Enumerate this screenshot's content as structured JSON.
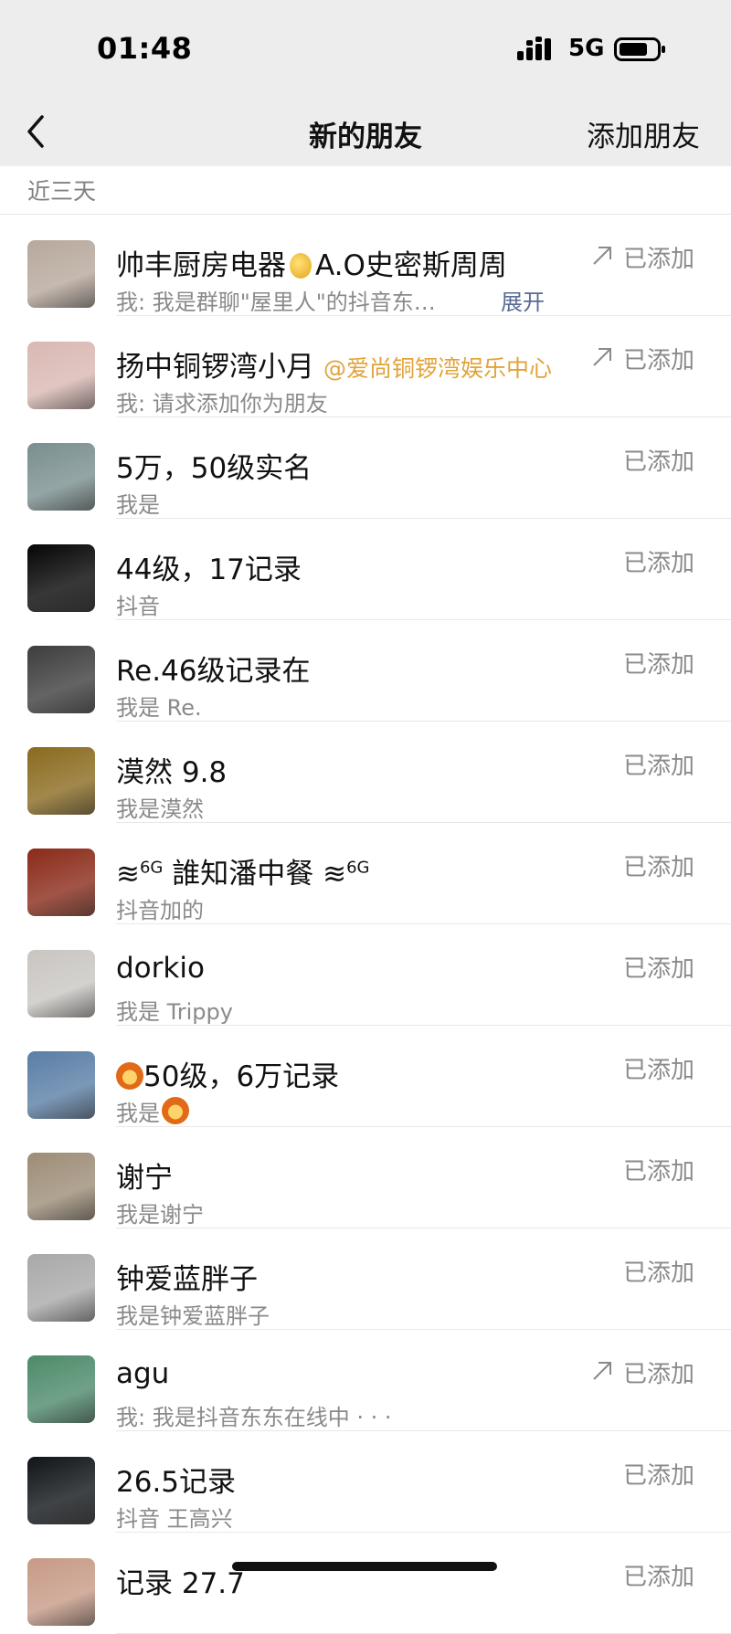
{
  "status_bar": {
    "time": "01:48",
    "network": "5G"
  },
  "nav": {
    "title": "新的朋友",
    "right_action": "添加朋友"
  },
  "section": {
    "label": "近三天"
  },
  "friends": [
    {
      "name": "帅丰厨房电器",
      "name_after": "A.O史密斯周周",
      "message": "我: 我是群聊\"屋里人\"的抖音东…",
      "expand": "展开",
      "status": "已添加",
      "shared": true,
      "avatar_color": "#b7a89c"
    },
    {
      "name": "扬中铜锣湾小月",
      "tag": "@爱尚铜锣湾娱乐中心",
      "message": "我: 请求添加你为朋友",
      "status": "已添加",
      "shared": true,
      "avatar_color": "#d9b8b3"
    },
    {
      "name": "5万，50级实名",
      "message": "我是",
      "status": "已添加",
      "shared": false,
      "avatar_color": "#7a8f8f"
    },
    {
      "name": "44级，17记录",
      "message": "抖音",
      "status": "已添加",
      "shared": false,
      "avatar_color": "#050505"
    },
    {
      "name": "Re.46级记录在",
      "message": "我是 Re.",
      "status": "已添加",
      "shared": false,
      "avatar_color": "#3d3d3d"
    },
    {
      "name": "漠然 9.8",
      "message": "我是漠然",
      "status": "已添加",
      "shared": false,
      "avatar_color": "#8a6a1e"
    },
    {
      "name": "誰知潘中餐",
      "message": "抖音加的",
      "status": "已添加",
      "shared": false,
      "avatar_color": "#8a2a18",
      "signal_prefix": "6G",
      "signal_suffix": "6G"
    },
    {
      "name": "dorkio",
      "message": "我是 Trippy",
      "status": "已添加",
      "shared": false,
      "avatar_color": "#c9c6c2"
    },
    {
      "name": "50级，6万记录",
      "message": "我是",
      "status": "已添加",
      "shared": false,
      "avatar_color": "#5a7ea6",
      "lion": true
    },
    {
      "name": "谢宁",
      "message": "我是谢宁",
      "status": "已添加",
      "shared": false,
      "avatar_color": "#9d8d77"
    },
    {
      "name": "钟爱蓝胖子",
      "message": "我是钟爱蓝胖子",
      "status": "已添加",
      "shared": false,
      "avatar_color": "#a9a9a9"
    },
    {
      "name": "agu",
      "message": "我: 我是抖音东东在线中 · · ·",
      "status": "已添加",
      "shared": true,
      "avatar_color": "#4d8a6a"
    },
    {
      "name": "26.5记录",
      "message": "抖音  王高兴",
      "status": "已添加",
      "shared": false,
      "avatar_color": "#101418"
    },
    {
      "name": "记录 27.7",
      "message": "",
      "status": "已添加",
      "shared": false,
      "avatar_color": "#c79a86"
    }
  ],
  "colors": {
    "background": "#ffffff",
    "header": "#ededed",
    "tag": "#e2a33a",
    "link": "#576b95"
  }
}
